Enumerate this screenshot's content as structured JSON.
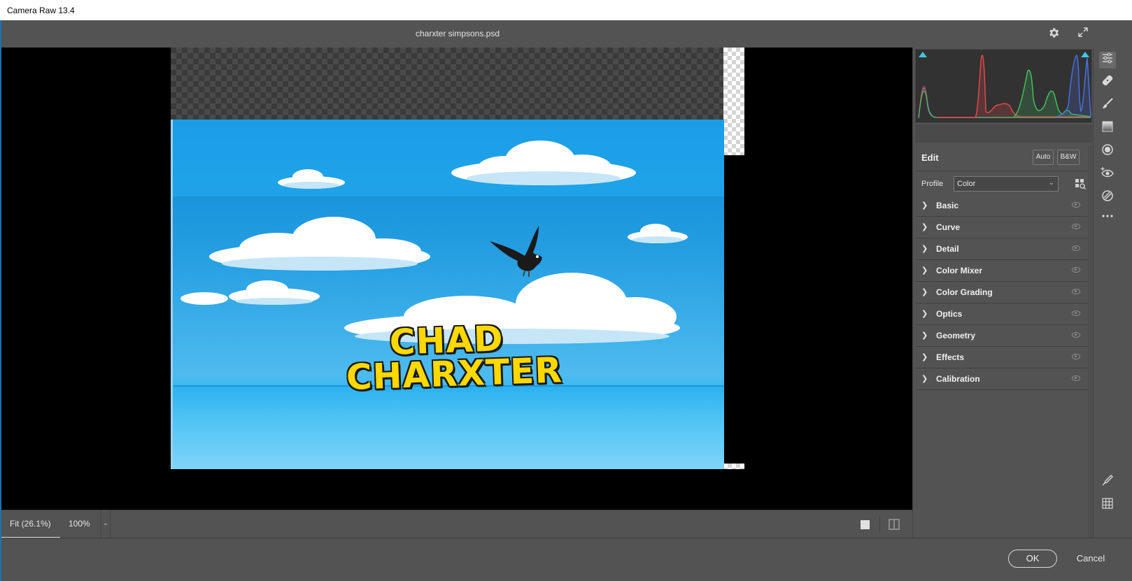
{
  "window": {
    "title": "Camera Raw 13.4"
  },
  "document": {
    "title": "charxter simpsons.psd"
  },
  "header_icons": [
    "gear-icon",
    "fullscreen-icon"
  ],
  "image": {
    "text_line1": "CHAD",
    "text_line2": "CHARXTER"
  },
  "canvas_toolbar": {
    "zoom_fit_label": "Fit (26.1%)",
    "zoom_100_label": "100%",
    "zoom_dropdown_icon": "chevron-down-icon"
  },
  "edit_panel": {
    "title": "Edit",
    "auto_label": "Auto",
    "bw_label": "B&W",
    "profile_label": "Profile",
    "profile_value": "Color",
    "sections": [
      {
        "label": "Basic"
      },
      {
        "label": "Curve"
      },
      {
        "label": "Detail"
      },
      {
        "label": "Color Mixer"
      },
      {
        "label": "Color Grading"
      },
      {
        "label": "Optics"
      },
      {
        "label": "Geometry"
      },
      {
        "label": "Effects"
      },
      {
        "label": "Calibration"
      }
    ]
  },
  "tools": [
    "edit-icon",
    "healing-icon",
    "brush-icon",
    "linear-gradient-icon",
    "radial-gradient-icon",
    "red-eye-icon",
    "presets-icon",
    "more-icon",
    "sampler-icon",
    "grid-icon"
  ],
  "footer": {
    "ok_label": "OK",
    "cancel_label": "Cancel"
  },
  "colors": {
    "accent_clip": "#3cc8e0",
    "panel_bg": "#535353",
    "canvas_bg": "#000000"
  }
}
